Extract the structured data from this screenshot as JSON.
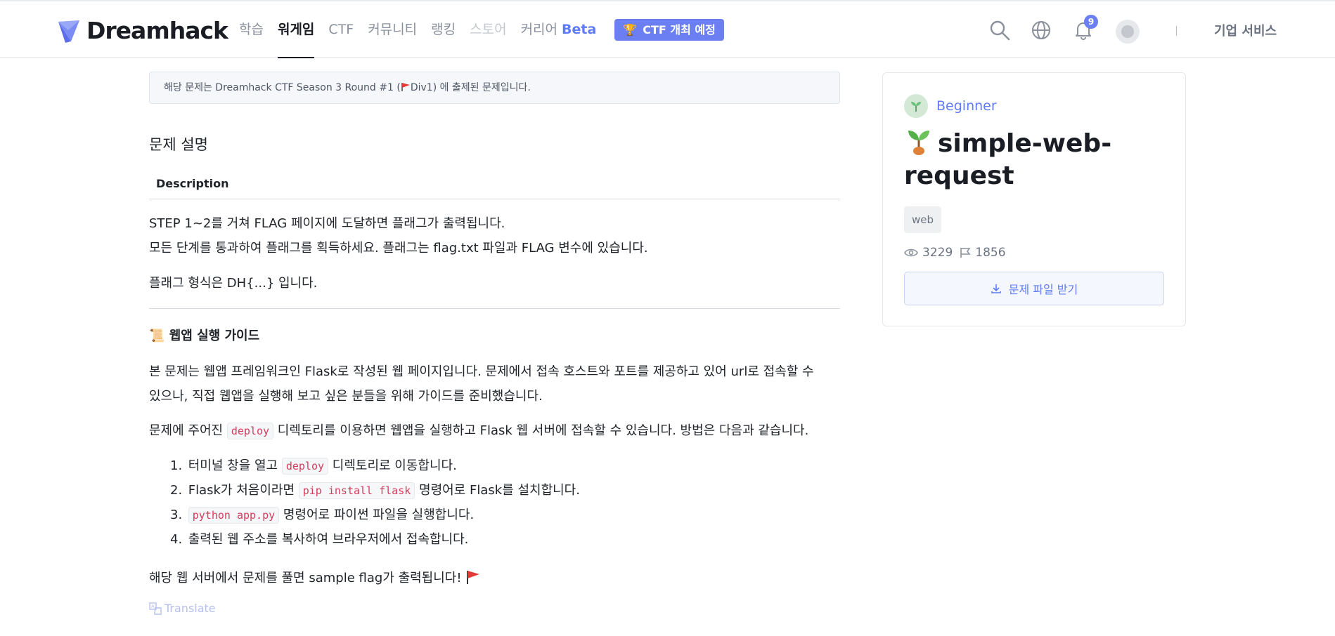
{
  "header": {
    "brand": "Dreamhack",
    "nav": [
      {
        "label": "학습",
        "state": "normal"
      },
      {
        "label": "워게임",
        "state": "active"
      },
      {
        "label": "CTF",
        "state": "normal"
      },
      {
        "label": "커뮤니티",
        "state": "normal"
      },
      {
        "label": "랭킹",
        "state": "normal"
      },
      {
        "label": "스토어",
        "state": "disabled"
      },
      {
        "label": "커리어",
        "state": "normal",
        "suffix": "Beta"
      }
    ],
    "ctf_badge": "CTF 개최 예정",
    "notification_count": "9",
    "separator": "|",
    "business_link": "기업 서비스",
    "icons": [
      "search-icon",
      "globe-icon",
      "bell-icon",
      "avatar"
    ],
    "accent_color": "#6b7ff2"
  },
  "notice": {
    "prefix": "해당 문제는 Dreamhack CTF Season 3 Round #1 (",
    "division": "Div1",
    "suffix": ") 에 출제된 문제입니다."
  },
  "problem": {
    "section_title": "문제 설명",
    "tab_label": "Description",
    "paragraphs": [
      "STEP 1~2를 거쳐 FLAG 페이지에 도달하면 플래그가 출력됩니다.",
      "모든 단계를 통과하여 플래그를 획득하세요. 플래그는 flag.txt 파일과 FLAG 변수에 있습니다.",
      "플래그 형식은 DH{...} 입니다."
    ],
    "guide_title": "웹앱 실행 가이드",
    "guide_paragraph_1": "본 문제는 웹앱 프레임워크인 Flask로 작성된 웹 페이지입니다. 문제에서 접속 호스트와 포트를 제공하고 있어 url로 접속할 수",
    "guide_paragraph_2": "있으나, 직접 웹앱을 실행해 보고 싶은 분들을 위해 가이드를 준비했습니다.",
    "guide_paragraph_3_pre": "문제에 주어진",
    "guide_paragraph_3_code": "deploy",
    "guide_paragraph_3_post": "디렉토리를 이용하면 웹앱을 실행하고 Flask 웹 서버에 접속할 수 있습니다. 방법은 다음과 같습니다.",
    "steps": [
      {
        "num": "1.",
        "pre": "터미널 창을 열고",
        "code": "deploy",
        "post": "디렉토리로 이동합니다."
      },
      {
        "num": "2.",
        "pre": "Flask가 처음이라면",
        "code": "pip install flask",
        "post": "명령어로 Flask를 설치합니다."
      },
      {
        "num": "3.",
        "pre": "",
        "code": "python app.py",
        "post": "명령어로 파이썬 파일을 실행합니다."
      },
      {
        "num": "4.",
        "pre": "출력된 웹 주소를 복사하여 브라우저에서 접속합니다.",
        "code": "",
        "post": ""
      }
    ],
    "closing": "해당 웹 서버에서 문제를 풀면 sample flag가 출력됩니다!",
    "translate_label": "Translate"
  },
  "sidebar": {
    "level": "Beginner",
    "title": "simple-web-request",
    "tag": "web",
    "views": "3229",
    "solves": "1856",
    "download_label": "문제 파일 받기"
  }
}
